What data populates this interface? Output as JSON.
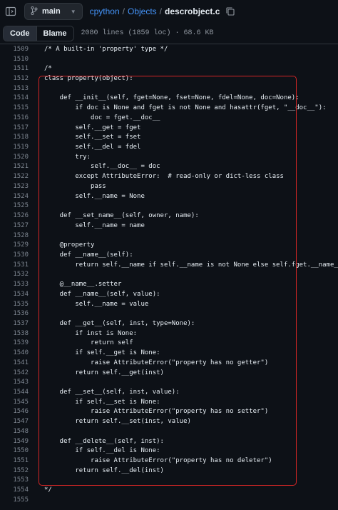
{
  "header": {
    "branch": "main",
    "breadcrumb": [
      "cpython",
      "Objects",
      "descrobject.c"
    ]
  },
  "tabs": {
    "code": "Code",
    "blame": "Blame"
  },
  "file_meta": "2080 lines (1859 loc) · 68.6 KB",
  "code_lines": [
    {
      "n": "1509",
      "t": "/* A built-in 'property' type */"
    },
    {
      "n": "1510",
      "t": ""
    },
    {
      "n": "1511",
      "t": "/*"
    },
    {
      "n": "1512",
      "t": "class property(object):"
    },
    {
      "n": "1513",
      "t": ""
    },
    {
      "n": "1514",
      "t": "    def __init__(self, fget=None, fset=None, fdel=None, doc=None):"
    },
    {
      "n": "1515",
      "t": "        if doc is None and fget is not None and hasattr(fget, \"__doc__\"):"
    },
    {
      "n": "1516",
      "t": "            doc = fget.__doc__"
    },
    {
      "n": "1517",
      "t": "        self.__get = fget"
    },
    {
      "n": "1518",
      "t": "        self.__set = fset"
    },
    {
      "n": "1519",
      "t": "        self.__del = fdel"
    },
    {
      "n": "1520",
      "t": "        try:"
    },
    {
      "n": "1521",
      "t": "            self.__doc__ = doc"
    },
    {
      "n": "1522",
      "t": "        except AttributeError:  # read-only or dict-less class"
    },
    {
      "n": "1523",
      "t": "            pass"
    },
    {
      "n": "1524",
      "t": "        self.__name = None"
    },
    {
      "n": "1525",
      "t": ""
    },
    {
      "n": "1526",
      "t": "    def __set_name__(self, owner, name):"
    },
    {
      "n": "1527",
      "t": "        self.__name = name"
    },
    {
      "n": "1528",
      "t": ""
    },
    {
      "n": "1529",
      "t": "    @property"
    },
    {
      "n": "1530",
      "t": "    def __name__(self):"
    },
    {
      "n": "1531",
      "t": "        return self.__name if self.__name is not None else self.fget.__name__"
    },
    {
      "n": "1532",
      "t": ""
    },
    {
      "n": "1533",
      "t": "    @__name__.setter"
    },
    {
      "n": "1534",
      "t": "    def __name__(self, value):"
    },
    {
      "n": "1535",
      "t": "        self.__name = value"
    },
    {
      "n": "1536",
      "t": ""
    },
    {
      "n": "1537",
      "t": "    def __get__(self, inst, type=None):"
    },
    {
      "n": "1538",
      "t": "        if inst is None:"
    },
    {
      "n": "1539",
      "t": "            return self"
    },
    {
      "n": "1540",
      "t": "        if self.__get is None:"
    },
    {
      "n": "1541",
      "t": "            raise AttributeError(\"property has no getter\")"
    },
    {
      "n": "1542",
      "t": "        return self.__get(inst)"
    },
    {
      "n": "1543",
      "t": ""
    },
    {
      "n": "1544",
      "t": "    def __set__(self, inst, value):"
    },
    {
      "n": "1545",
      "t": "        if self.__set is None:"
    },
    {
      "n": "1546",
      "t": "            raise AttributeError(\"property has no setter\")"
    },
    {
      "n": "1547",
      "t": "        return self.__set(inst, value)"
    },
    {
      "n": "1548",
      "t": ""
    },
    {
      "n": "1549",
      "t": "    def __delete__(self, inst):"
    },
    {
      "n": "1550",
      "t": "        if self.__del is None:"
    },
    {
      "n": "1551",
      "t": "            raise AttributeError(\"property has no deleter\")"
    },
    {
      "n": "1552",
      "t": "        return self.__del(inst)"
    },
    {
      "n": "1553",
      "t": ""
    },
    {
      "n": "1554",
      "t": "*/"
    },
    {
      "n": "1555",
      "t": ""
    }
  ],
  "colors": {
    "background": "#0d1117",
    "link": "#4493f8",
    "annotation_box": "#d52626",
    "line_number": "#7d8590"
  },
  "icons": [
    "sidebar-toggle-icon",
    "branch-icon",
    "chevron-down-icon",
    "copy-icon"
  ]
}
